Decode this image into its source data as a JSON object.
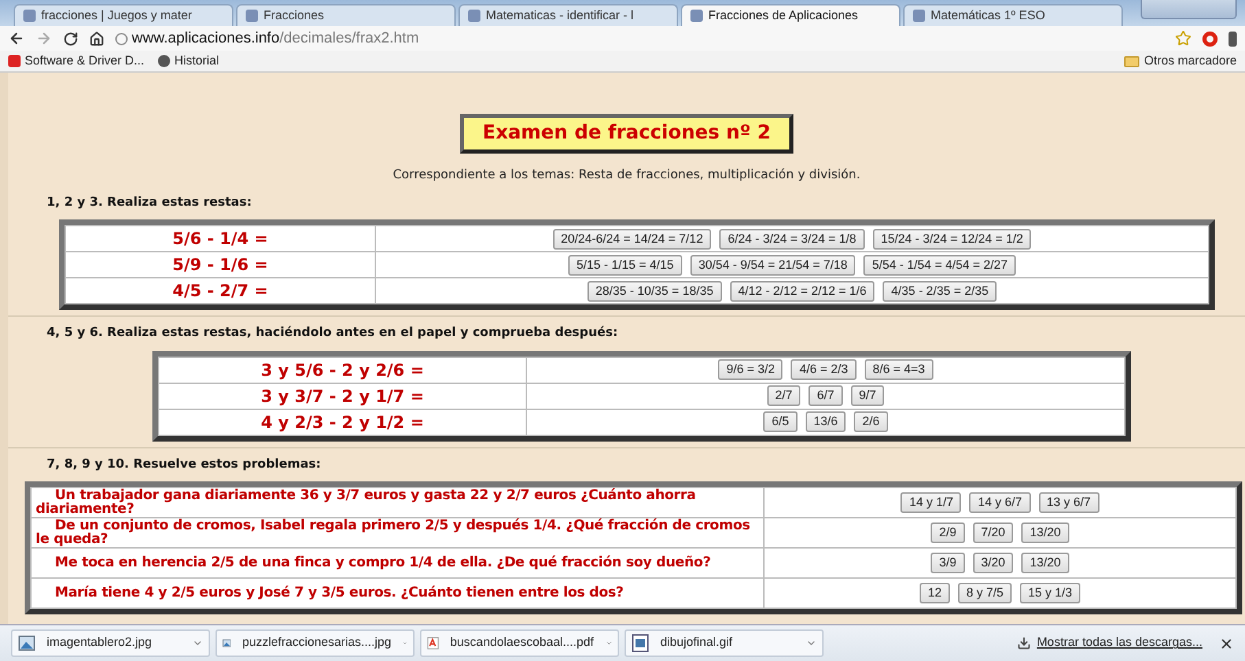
{
  "browser": {
    "tabs": [
      {
        "title": "fracciones | Juegos y mater",
        "selected": false
      },
      {
        "title": "Fracciones",
        "selected": false
      },
      {
        "title": "Matematicas - identificar - l",
        "selected": false
      },
      {
        "title": "Fracciones de Aplicaciones",
        "selected": true
      },
      {
        "title": "Matemáticas 1º ESO",
        "selected": false
      }
    ],
    "url": {
      "domain": "www.aplicaciones.info",
      "path": "/decimales/frax2.htm"
    },
    "bookmarks": [
      "Software & Driver D...",
      "Historial"
    ],
    "other_bookmarks": "Otros marcadore"
  },
  "page": {
    "title": "Examen de fracciones nº 2",
    "subtitle": "Correspondiente a los temas: Resta de fracciones, multiplicación y división.",
    "sections": [
      {
        "heading": "1, 2 y 3. Realiza estas restas:",
        "kind": "wide",
        "rows": [
          {
            "prompt": "5/6 - 1/4 =",
            "options": [
              "20/24-6/24 = 14/24 = 7/12",
              "6/24 - 3/24 = 3/24 = 1/8",
              "15/24 - 3/24 = 12/24 = 1/2"
            ]
          },
          {
            "prompt": "5/9 - 1/6 =",
            "options": [
              "5/15 - 1/15 = 4/15",
              "30/54 - 9/54 = 21/54 = 7/18",
              "5/54 - 1/54 = 4/54 = 2/27"
            ]
          },
          {
            "prompt": "4/5 - 2/7 =",
            "options": [
              "28/35 - 10/35 = 18/35",
              "4/12 - 2/12 = 2/12 = 1/6",
              "4/35 - 2/35 = 2/35"
            ]
          }
        ]
      },
      {
        "heading": "4, 5 y 6. Realiza estas restas, haciéndolo antes en el papel y comprueba después:",
        "kind": "narrow",
        "rows": [
          {
            "prompt": "3 y 5/6 - 2 y 2/6 =",
            "options": [
              "9/6 = 3/2",
              "4/6 = 2/3",
              "8/6 = 4=3"
            ]
          },
          {
            "prompt": "3 y 3/7 - 2 y 1/7 =",
            "options": [
              "2/7",
              "6/7",
              "9/7"
            ]
          },
          {
            "prompt": "4 y 2/3 - 2 y 1/2 =",
            "options": [
              "6/5",
              "13/6",
              "2/6"
            ]
          }
        ]
      },
      {
        "heading": "7, 8, 9 y 10.  Resuelve estos problemas:",
        "kind": "problems",
        "rows": [
          {
            "prompt": "Un trabajador gana diariamente 36 y 3/7 euros y gasta 22 y 2/7 euros ¿Cuánto ahorra diariamente?",
            "options": [
              "14 y 1/7",
              "14 y 6/7",
              "13 y 6/7"
            ]
          },
          {
            "prompt": "De un conjunto de cromos, Isabel regala primero 2/5 y después 1/4. ¿Qué fracción de cromos le queda?",
            "options": [
              "2/9",
              "7/20",
              "13/20"
            ]
          },
          {
            "prompt": "Me toca en herencia 2/5 de una finca y compro 1/4 de ella. ¿De qué fracción soy dueño?",
            "options": [
              "3/9",
              "3/20",
              "13/20"
            ]
          },
          {
            "prompt": "María tiene 4 y 2/5 euros y José 7 y 3/5 euros. ¿Cuánto tienen entre los dos?",
            "options": [
              "12",
              "8 y 7/5",
              "15 y 1/3"
            ]
          }
        ]
      }
    ]
  },
  "downloads": {
    "files": [
      {
        "name": "imagentablero2.jpg",
        "kind": "image"
      },
      {
        "name": "puzzlefraccionesarias....jpg",
        "kind": "image"
      },
      {
        "name": "buscandolaescobaal....pdf",
        "kind": "pdf"
      },
      {
        "name": "dibujofinal.gif",
        "kind": "gif"
      }
    ],
    "show_all": "Mostrar todas las descargas..."
  }
}
